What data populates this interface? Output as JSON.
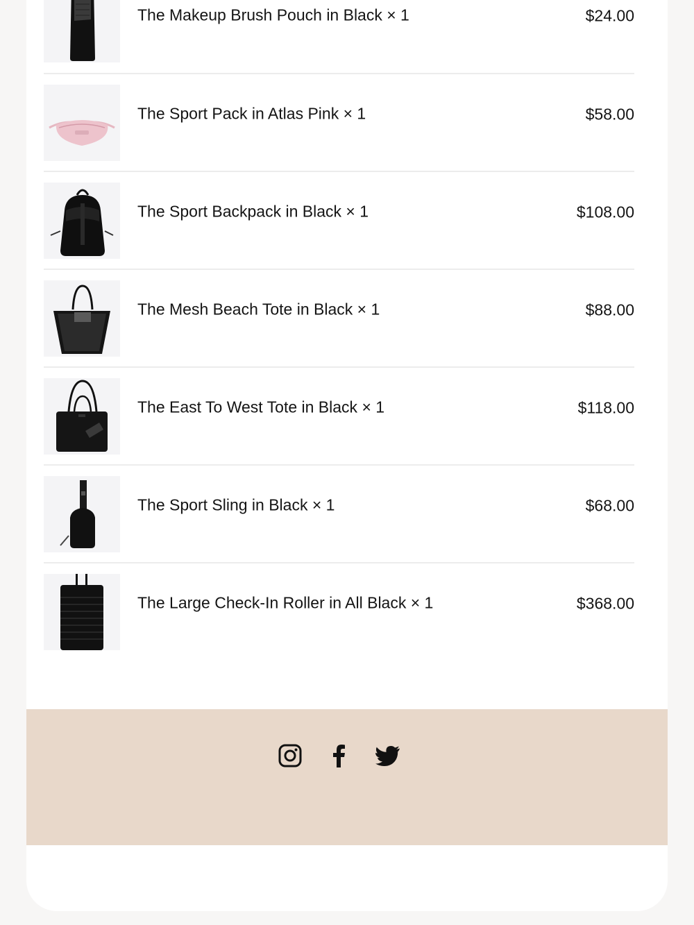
{
  "colors": {
    "page_background": "#f7f6f5",
    "card_background": "#ffffff",
    "thumb_background": "#f4f4f6",
    "footer_background": "#e8d8ca",
    "text": "#141414",
    "divider": "#ececec"
  },
  "line_items": [
    {
      "name": "The Makeup Brush Pouch in Black × 1",
      "price": "$24.00",
      "image_icon": "makeup-brush-pouch-black"
    },
    {
      "name": "The Sport Pack in Atlas Pink × 1",
      "price": "$58.00",
      "image_icon": "sport-pack-atlas-pink"
    },
    {
      "name": "The Sport Backpack in Black × 1",
      "price": "$108.00",
      "image_icon": "sport-backpack-black"
    },
    {
      "name": "The Mesh Beach Tote in Black × 1",
      "price": "$88.00",
      "image_icon": "mesh-beach-tote-black"
    },
    {
      "name": "The East To West Tote in Black × 1",
      "price": "$118.00",
      "image_icon": "east-to-west-tote-black"
    },
    {
      "name": "The Sport Sling in Black × 1",
      "price": "$68.00",
      "image_icon": "sport-sling-black"
    },
    {
      "name": "The Large Check-In Roller in All Black × 1",
      "price": "$368.00",
      "image_icon": "large-check-in-roller-black"
    }
  ],
  "footer": {
    "social_icons": [
      "instagram-icon",
      "facebook-icon",
      "twitter-icon"
    ]
  }
}
